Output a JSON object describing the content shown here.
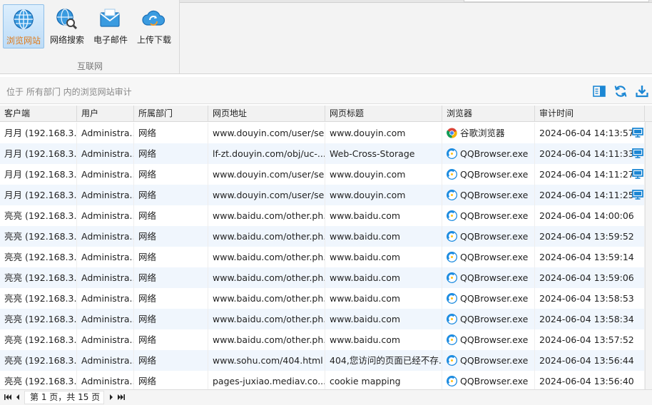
{
  "ribbon": {
    "buttons": [
      {
        "label": "浏览网站",
        "icon": "globe-icon",
        "active": true
      },
      {
        "label": "网络搜索",
        "icon": "globe-search-icon",
        "active": false
      },
      {
        "label": "电子邮件",
        "icon": "envelope-icon",
        "active": false
      },
      {
        "label": "上传下载",
        "icon": "cloud-sync-icon",
        "active": false
      }
    ],
    "group_label": "互联网"
  },
  "location": {
    "text": "位于 所有部门 内的浏览网站审计",
    "tools": [
      "panel-toggle-icon",
      "refresh-icon",
      "download-icon"
    ]
  },
  "grid": {
    "columns": [
      "客户端",
      "用户",
      "所属部门",
      "网页地址",
      "网页标题",
      "浏览器",
      "审计时间"
    ],
    "rows": [
      {
        "client": "月月 (192.168.3...",
        "user": "Administra...",
        "dept": "网络",
        "url": "www.douyin.com/user/se...",
        "title": "www.douyin.com",
        "browser": "谷歌浏览器",
        "browser_icon": "chrome-icon",
        "time": "2024-06-04 14:13:57",
        "monitor": true
      },
      {
        "client": "月月 (192.168.3...",
        "user": "Administra...",
        "dept": "网络",
        "url": "lf-zt.douyin.com/obj/uc-...",
        "title": "Web-Cross-Storage",
        "browser": "QQBrowser.exe",
        "browser_icon": "qqbrowser-icon",
        "time": "2024-06-04 14:11:33",
        "monitor": true
      },
      {
        "client": "月月 (192.168.3...",
        "user": "Administra...",
        "dept": "网络",
        "url": "www.douyin.com/user/se...",
        "title": "www.douyin.com",
        "browser": "QQBrowser.exe",
        "browser_icon": "qqbrowser-icon",
        "time": "2024-06-04 14:11:27",
        "monitor": true
      },
      {
        "client": "月月 (192.168.3...",
        "user": "Administra...",
        "dept": "网络",
        "url": "www.douyin.com/user/se...",
        "title": "www.douyin.com",
        "browser": "QQBrowser.exe",
        "browser_icon": "qqbrowser-icon",
        "time": "2024-06-04 14:11:25",
        "monitor": true
      },
      {
        "client": "亮亮 (192.168.3...",
        "user": "Administra...",
        "dept": "网络",
        "url": "www.baidu.com/other.ph...",
        "title": "www.baidu.com",
        "browser": "QQBrowser.exe",
        "browser_icon": "qqbrowser-icon",
        "time": "2024-06-04 14:00:06",
        "monitor": false
      },
      {
        "client": "亮亮 (192.168.3...",
        "user": "Administra...",
        "dept": "网络",
        "url": "www.baidu.com/other.ph...",
        "title": "www.baidu.com",
        "browser": "QQBrowser.exe",
        "browser_icon": "qqbrowser-icon",
        "time": "2024-06-04 13:59:52",
        "monitor": false
      },
      {
        "client": "亮亮 (192.168.3...",
        "user": "Administra...",
        "dept": "网络",
        "url": "www.baidu.com/other.ph...",
        "title": "www.baidu.com",
        "browser": "QQBrowser.exe",
        "browser_icon": "qqbrowser-icon",
        "time": "2024-06-04 13:59:14",
        "monitor": false
      },
      {
        "client": "亮亮 (192.168.3...",
        "user": "Administra...",
        "dept": "网络",
        "url": "www.baidu.com/other.ph...",
        "title": "www.baidu.com",
        "browser": "QQBrowser.exe",
        "browser_icon": "qqbrowser-icon",
        "time": "2024-06-04 13:59:06",
        "monitor": false
      },
      {
        "client": "亮亮 (192.168.3...",
        "user": "Administra...",
        "dept": "网络",
        "url": "www.baidu.com/other.ph...",
        "title": "www.baidu.com",
        "browser": "QQBrowser.exe",
        "browser_icon": "qqbrowser-icon",
        "time": "2024-06-04 13:58:53",
        "monitor": false
      },
      {
        "client": "亮亮 (192.168.3...",
        "user": "Administra...",
        "dept": "网络",
        "url": "www.baidu.com/other.ph...",
        "title": "www.baidu.com",
        "browser": "QQBrowser.exe",
        "browser_icon": "qqbrowser-icon",
        "time": "2024-06-04 13:58:34",
        "monitor": false
      },
      {
        "client": "亮亮 (192.168.3...",
        "user": "Administra...",
        "dept": "网络",
        "url": "www.baidu.com/other.ph...",
        "title": "www.baidu.com",
        "browser": "QQBrowser.exe",
        "browser_icon": "qqbrowser-icon",
        "time": "2024-06-04 13:57:52",
        "monitor": false
      },
      {
        "client": "亮亮 (192.168.3...",
        "user": "Administra...",
        "dept": "网络",
        "url": "www.sohu.com/404.html",
        "title": "404,您访问的页面已经不存...",
        "browser": "QQBrowser.exe",
        "browser_icon": "qqbrowser-icon",
        "time": "2024-06-04 13:56:44",
        "monitor": false
      },
      {
        "client": "亮亮 (192.168.3...",
        "user": "Administra...",
        "dept": "网络",
        "url": "pages-juxiao.mediav.co...",
        "title": "cookie mapping",
        "browser": "QQBrowser.exe",
        "browser_icon": "qqbrowser-icon",
        "time": "2024-06-04 13:56:40",
        "monitor": false
      }
    ]
  },
  "pager": {
    "text": "第 1 页，共 15 页"
  },
  "colors": {
    "accent": "#1c87d4",
    "active_label": "#e07a18",
    "row_alt": "#f0f6fd"
  }
}
